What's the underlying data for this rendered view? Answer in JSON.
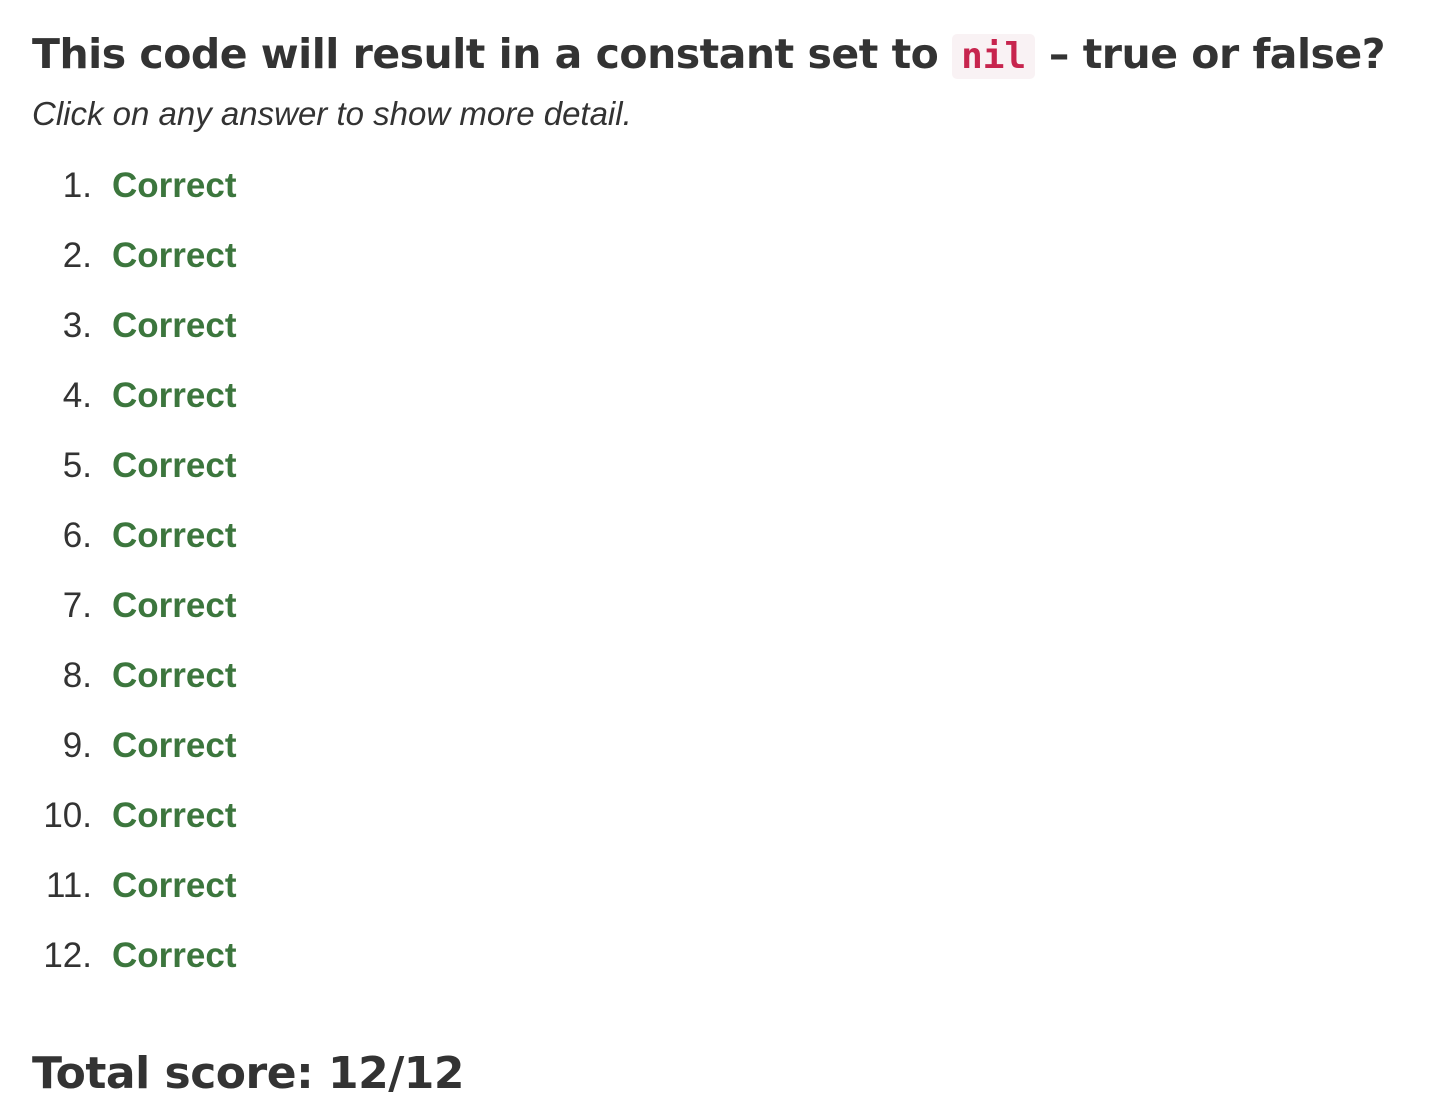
{
  "question": {
    "title_before": "This code will result in a constant set to ",
    "title_code": "nil",
    "title_after": " – true or false?",
    "instructions": "Click on any answer to show more detail."
  },
  "answers": [
    {
      "number": "1.",
      "result": "Correct"
    },
    {
      "number": "2.",
      "result": "Correct"
    },
    {
      "number": "3.",
      "result": "Correct"
    },
    {
      "number": "4.",
      "result": "Correct"
    },
    {
      "number": "5.",
      "result": "Correct"
    },
    {
      "number": "6.",
      "result": "Correct"
    },
    {
      "number": "7.",
      "result": "Correct"
    },
    {
      "number": "8.",
      "result": "Correct"
    },
    {
      "number": "9.",
      "result": "Correct"
    },
    {
      "number": "10.",
      "result": "Correct"
    },
    {
      "number": "11.",
      "result": "Correct"
    },
    {
      "number": "12.",
      "result": "Correct"
    }
  ],
  "score": {
    "label": "Total score: 12/12"
  },
  "colors": {
    "correct": "#3c763d",
    "code_text": "#c7254e",
    "code_background": "#f9f2f4"
  }
}
